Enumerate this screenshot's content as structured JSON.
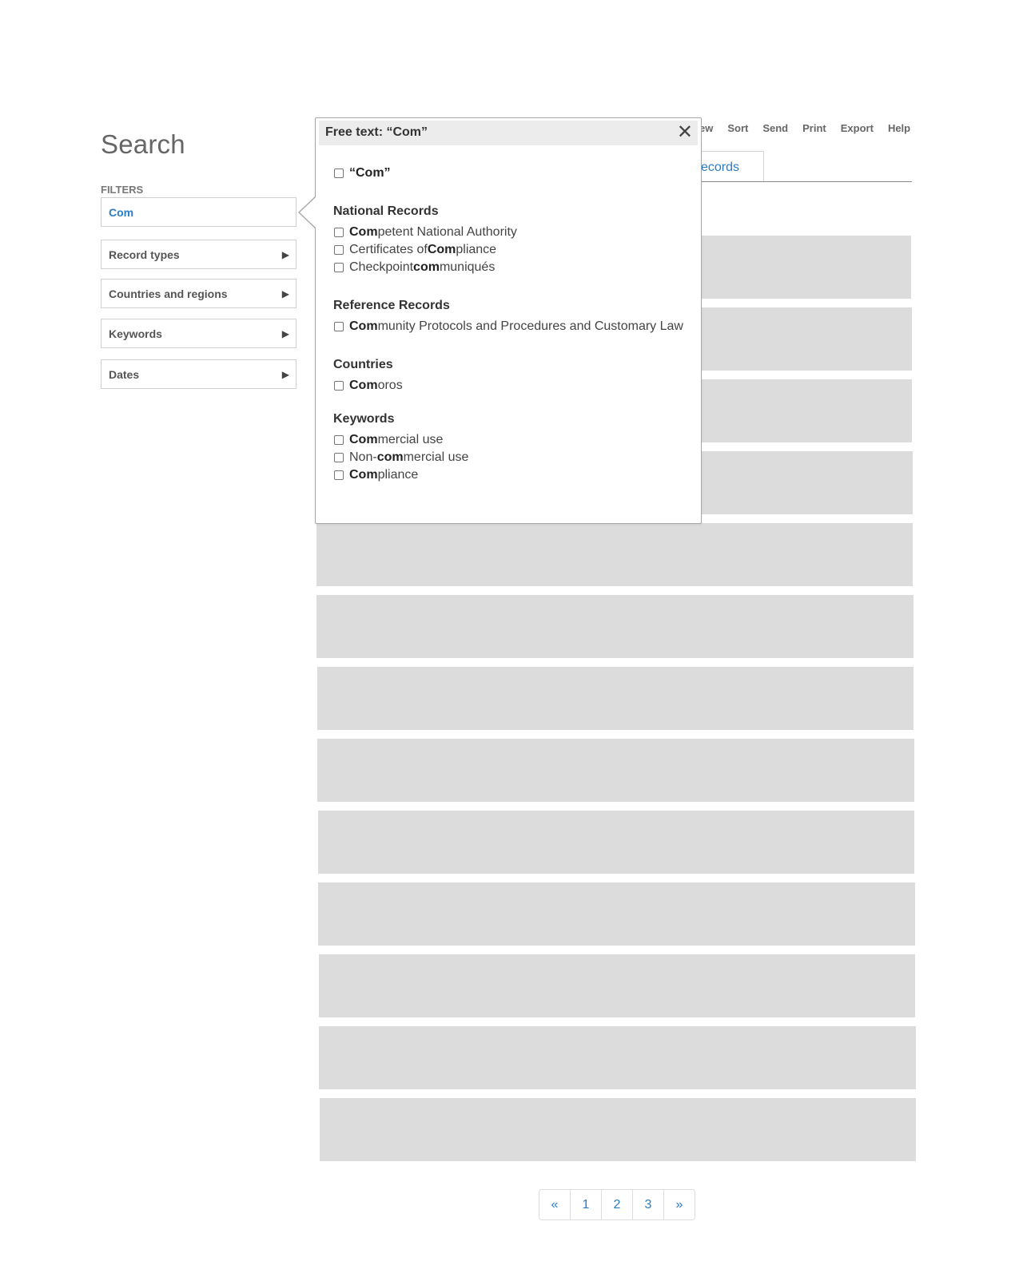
{
  "page": {
    "title": "Search"
  },
  "filters": {
    "label": "FILTERS",
    "free_text_value": "Com",
    "items": [
      {
        "label": "Record types"
      },
      {
        "label": "Countries and regions"
      },
      {
        "label": "Keywords"
      },
      {
        "label": "Dates"
      }
    ],
    "expand_icon": "▶"
  },
  "toolbar": {
    "items": [
      "ew",
      "Sort",
      "Send",
      "Print",
      "Export",
      "Help"
    ]
  },
  "tab": {
    "label": "ecords"
  },
  "popover": {
    "title": "Free text: “Com”",
    "close_icon": "✕",
    "quoted_option": "“Com”",
    "groups": [
      {
        "title": "National Records",
        "options": [
          {
            "pre": "",
            "bold": "Com",
            "post": "petent National Authority"
          },
          {
            "pre": "Certificates of ",
            "bold": "Com",
            "post": "pliance"
          },
          {
            "pre": "Checkpoint ",
            "bold": "com",
            "post": "muniqués"
          }
        ]
      },
      {
        "title": "Reference Records",
        "options": [
          {
            "pre": "",
            "bold": "Com",
            "post": "munity Protocols and Procedures and Customary Law"
          }
        ]
      },
      {
        "title": "Countries",
        "options": [
          {
            "pre": "",
            "bold": "Com",
            "post": "oros"
          }
        ]
      },
      {
        "title": "Keywords",
        "options": [
          {
            "pre": "",
            "bold": "Com",
            "post": "mercial use"
          },
          {
            "pre": "Non-",
            "bold": "com",
            "post": "mercial use"
          },
          {
            "pre": "",
            "bold": "Com",
            "post": "pliance"
          }
        ]
      }
    ]
  },
  "pagination": {
    "prev": "«",
    "pages": [
      "1",
      "2",
      "3"
    ],
    "next": "»"
  },
  "colors": {
    "link": "#2a7cc7",
    "placeholder_row": "#dcdcdc",
    "header_bg": "#ececec"
  }
}
